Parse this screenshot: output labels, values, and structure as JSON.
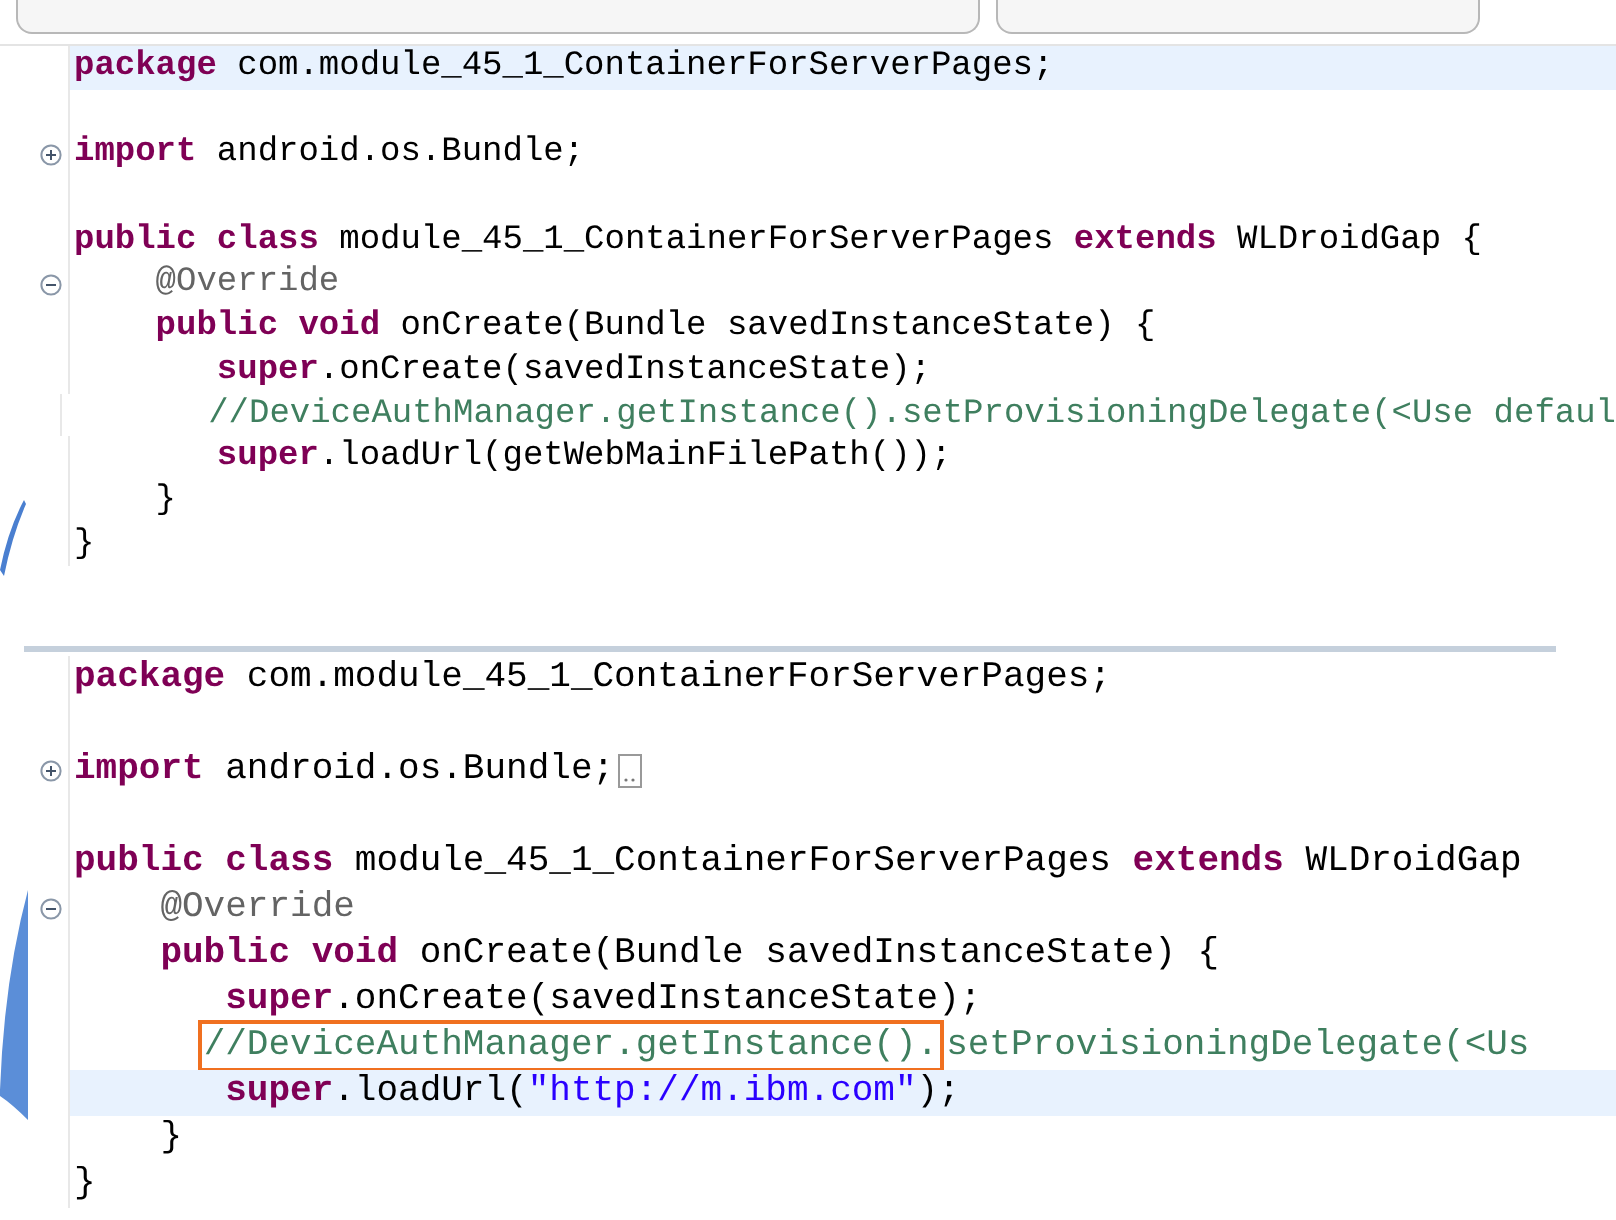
{
  "panels": [
    {
      "lines": [
        {
          "kind": "code",
          "current": true,
          "tokens": [
            {
              "kind": "keyword",
              "text": "package"
            },
            {
              "kind": "plain",
              "text": " com.module_45_1_ContainerForServerPages;"
            }
          ]
        },
        {
          "kind": "blank"
        },
        {
          "kind": "code",
          "current": false,
          "collapsed": true,
          "tokens": [
            {
              "kind": "keyword",
              "text": "import"
            },
            {
              "kind": "plain",
              "text": " android.os.Bundle;"
            }
          ]
        },
        {
          "kind": "blank"
        },
        {
          "kind": "code",
          "current": false,
          "tokens": [
            {
              "kind": "keyword",
              "text": "public class"
            },
            {
              "kind": "plain",
              "text": " module_45_1_ContainerForServerPages "
            },
            {
              "kind": "keyword",
              "text": "extends"
            },
            {
              "kind": "plain",
              "text": " WLDroidGap {"
            }
          ]
        },
        {
          "kind": "code",
          "current": false,
          "collapsed": false,
          "tokens": [
            {
              "kind": "annotation",
              "text": "    @Override"
            }
          ]
        },
        {
          "kind": "code",
          "current": false,
          "tokens": [
            {
              "kind": "keyword",
              "text": "    public void"
            },
            {
              "kind": "plain",
              "text": " onCreate(Bundle savedInstanceState) {"
            }
          ]
        },
        {
          "kind": "code",
          "current": false,
          "tokens": [
            {
              "kind": "keyword",
              "text": "       super"
            },
            {
              "kind": "plain",
              "text": ".onCreate(savedInstanceState);"
            }
          ]
        },
        {
          "kind": "code",
          "current": false,
          "tokens": [
            {
              "kind": "comment",
              "text": "       //DeviceAuthManager.getInstance().setProvisioningDelegate(<Use defaul"
            }
          ]
        },
        {
          "kind": "code",
          "current": false,
          "tokens": [
            {
              "kind": "keyword",
              "text": "       super"
            },
            {
              "kind": "plain",
              "text": ".loadUrl(getWebMainFilePath());"
            }
          ]
        },
        {
          "kind": "code",
          "current": false,
          "tokens": [
            {
              "kind": "plain",
              "text": "    }"
            }
          ]
        },
        {
          "kind": "code",
          "current": false,
          "tokens": [
            {
              "kind": "plain",
              "text": "}"
            }
          ]
        }
      ]
    },
    {
      "lines": [
        {
          "kind": "code",
          "current": false,
          "tokens": [
            {
              "kind": "keyword",
              "text": "package"
            },
            {
              "kind": "plain",
              "text": " com.module_45_1_ContainerForServerPages;"
            }
          ]
        },
        {
          "kind": "blank"
        },
        {
          "kind": "code",
          "current": false,
          "collapsed": true,
          "folded": true,
          "tokens": [
            {
              "kind": "keyword",
              "text": "import"
            },
            {
              "kind": "plain",
              "text": " android.os.Bundle;"
            }
          ]
        },
        {
          "kind": "blank"
        },
        {
          "kind": "code",
          "current": false,
          "tokens": [
            {
              "kind": "keyword",
              "text": "public class"
            },
            {
              "kind": "plain",
              "text": " module_45_1_ContainerForServerPages "
            },
            {
              "kind": "keyword",
              "text": "extends"
            },
            {
              "kind": "plain",
              "text": " WLDroidGap"
            }
          ]
        },
        {
          "kind": "code",
          "current": false,
          "collapsed": false,
          "tokens": [
            {
              "kind": "annotation",
              "text": "    @Override"
            }
          ]
        },
        {
          "kind": "code",
          "current": false,
          "tokens": [
            {
              "kind": "keyword",
              "text": "    public void"
            },
            {
              "kind": "plain",
              "text": " onCreate(Bundle savedInstanceState) {"
            }
          ]
        },
        {
          "kind": "code",
          "current": false,
          "tokens": [
            {
              "kind": "keyword",
              "text": "       super"
            },
            {
              "kind": "plain",
              "text": ".onCreate(savedInstanceState);"
            }
          ]
        },
        {
          "kind": "code",
          "current": false,
          "tokens": [
            {
              "kind": "comment",
              "text": "      //DeviceAuthManager.getInstance().",
              "boxed": true
            },
            {
              "kind": "comment",
              "text": "setProvisioningDelegate(<Us"
            }
          ]
        },
        {
          "kind": "code",
          "current": true,
          "tokens": [
            {
              "kind": "keyword",
              "text": "       super"
            },
            {
              "kind": "plain",
              "text": ".loadUrl("
            },
            {
              "kind": "string",
              "text": "\"http://m.ibm.com\""
            },
            {
              "kind": "plain",
              "text": ");"
            }
          ]
        },
        {
          "kind": "code",
          "current": false,
          "tokens": [
            {
              "kind": "plain",
              "text": "    }"
            }
          ]
        },
        {
          "kind": "code",
          "current": false,
          "tokens": [
            {
              "kind": "plain",
              "text": "}"
            }
          ]
        }
      ]
    }
  ]
}
